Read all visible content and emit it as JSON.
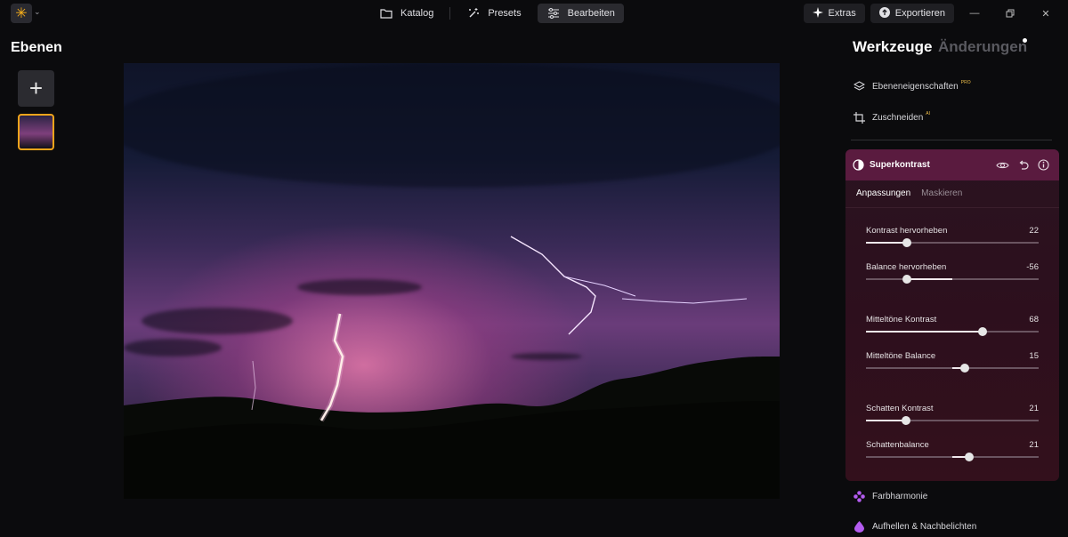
{
  "colors": {
    "accent": "#f2a41b",
    "card_header": "#5a1b3f",
    "violet": "#b45cf0"
  },
  "topbar": {
    "nav": [
      {
        "label": "Katalog",
        "icon": "folder-icon"
      },
      {
        "label": "Presets",
        "icon": "magic-wand-icon"
      },
      {
        "label": "Bearbeiten",
        "icon": "sliders-icon",
        "active": true
      }
    ],
    "extras_label": "Extras",
    "export_label": "Exportieren"
  },
  "left_panel": {
    "title": "Ebenen"
  },
  "right_panel": {
    "tab_tools": "Werkzeuge",
    "tab_changes": "Änderungen",
    "tools": [
      {
        "label": "Ebeneneigenschaften",
        "badge": "PRO",
        "icon": "layers-icon"
      },
      {
        "label": "Zuschneiden",
        "badge": "AI",
        "icon": "crop-icon"
      }
    ],
    "card": {
      "title": "Superkontrast",
      "subtabs": [
        "Anpassungen",
        "Maskieren"
      ],
      "sliders": [
        {
          "label": "Kontrast hervorheben",
          "value": "22",
          "pos": 0.235,
          "bipolar": false
        },
        {
          "label": "Balance hervorheben",
          "value": "-56",
          "pos": 0.235,
          "bipolar": true
        },
        {
          "label": "Mitteltöne Kontrast",
          "value": "68",
          "pos": 0.675,
          "bipolar": false
        },
        {
          "label": "Mitteltöne Balance",
          "value": "15",
          "pos": 0.57,
          "bipolar": true
        },
        {
          "label": "Schatten Kontrast",
          "value": "21",
          "pos": 0.23,
          "bipolar": false
        },
        {
          "label": "Schattenbalance",
          "value": "21",
          "pos": 0.6,
          "bipolar": true
        }
      ]
    },
    "more_tools": [
      {
        "label": "Farbharmonie",
        "icon": "flower-icon"
      },
      {
        "label": "Aufhellen & Nachbelichten",
        "icon": "drop-icon"
      }
    ]
  }
}
